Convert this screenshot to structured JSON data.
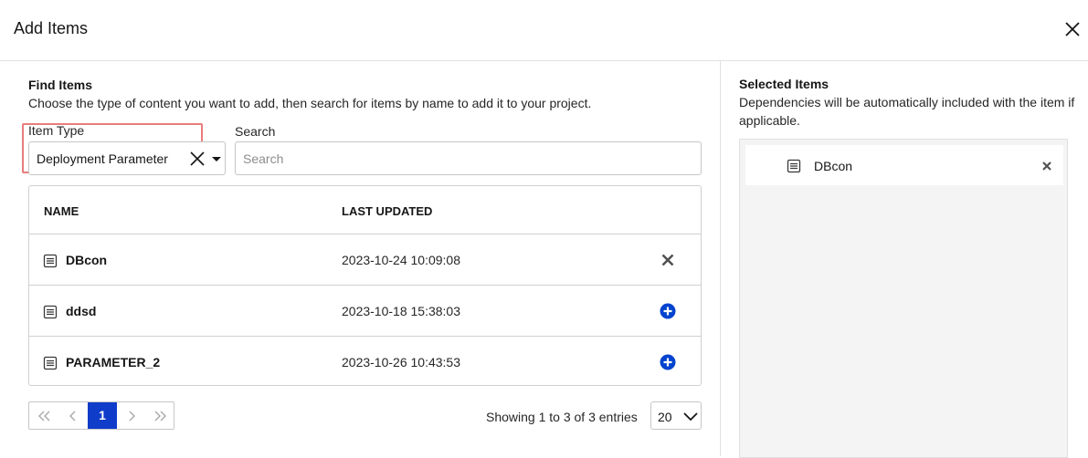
{
  "dialog": {
    "title": "Add Items"
  },
  "find": {
    "title": "Find Items",
    "description": "Choose the type of content you want to add, then search for items by name to add it to your project.",
    "item_type_label": "Item Type",
    "item_type_value": "Deployment Parameter",
    "search_label": "Search",
    "search_placeholder": "Search"
  },
  "table": {
    "columns": [
      "NAME",
      "LAST UPDATED"
    ],
    "rows": [
      {
        "name": "DBcon",
        "last_updated": "2023-10-24 10:09:08",
        "action": "remove"
      },
      {
        "name": "ddsd",
        "last_updated": "2023-10-18 15:38:03",
        "action": "add"
      },
      {
        "name": "PARAMETER_2",
        "last_updated": "2023-10-26 10:43:53",
        "action": "add"
      }
    ]
  },
  "pagination": {
    "current_page": "1",
    "showing_text": "Showing 1 to 3 of 3 entries",
    "page_size": "20"
  },
  "selected": {
    "title": "Selected Items",
    "description": "Dependencies will be automatically included with the item if applicable.",
    "items": [
      {
        "name": "DBcon"
      }
    ]
  },
  "colors": {
    "accent": "#0f3cc9",
    "add_icon": "#0043ce",
    "highlight": "#e87c7c"
  },
  "icons": {
    "close": "close-icon",
    "param": "parameter-icon",
    "add": "add-circle-icon",
    "remove": "remove-x-icon"
  }
}
